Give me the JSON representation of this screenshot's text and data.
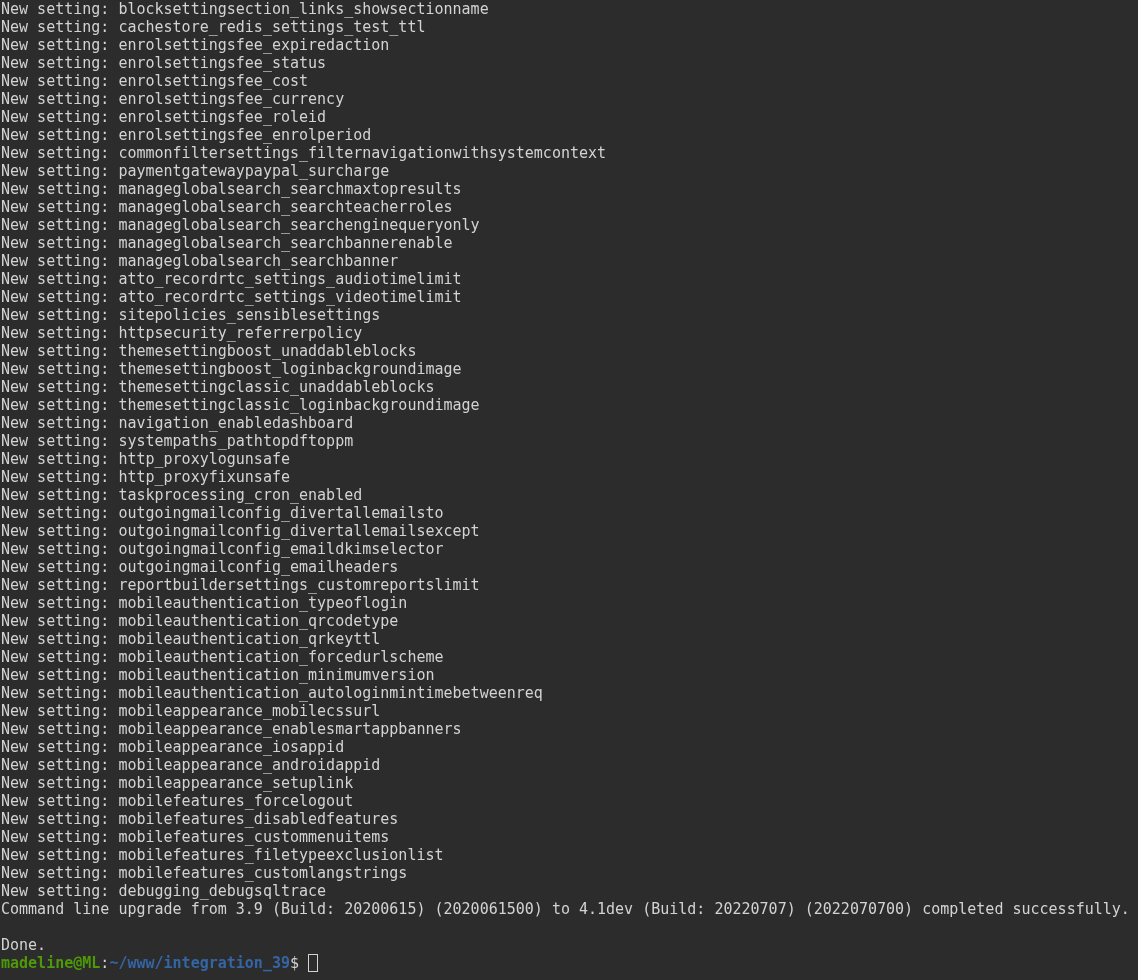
{
  "terminal": {
    "output": [
      "New setting: blocksettingsection_links_showsectionname",
      "New setting: cachestore_redis_settings_test_ttl",
      "New setting: enrolsettingsfee_expiredaction",
      "New setting: enrolsettingsfee_status",
      "New setting: enrolsettingsfee_cost",
      "New setting: enrolsettingsfee_currency",
      "New setting: enrolsettingsfee_roleid",
      "New setting: enrolsettingsfee_enrolperiod",
      "New setting: commonfiltersettings_filternavigationwithsystemcontext",
      "New setting: paymentgatewaypaypal_surcharge",
      "New setting: manageglobalsearch_searchmaxtopresults",
      "New setting: manageglobalsearch_searchteacherroles",
      "New setting: manageglobalsearch_searchenginequeryonly",
      "New setting: manageglobalsearch_searchbannerenable",
      "New setting: manageglobalsearch_searchbanner",
      "New setting: atto_recordrtc_settings_audiotimelimit",
      "New setting: atto_recordrtc_settings_videotimelimit",
      "New setting: sitepolicies_sensiblesettings",
      "New setting: httpsecurity_referrerpolicy",
      "New setting: themesettingboost_unaddableblocks",
      "New setting: themesettingboost_loginbackgroundimage",
      "New setting: themesettingclassic_unaddableblocks",
      "New setting: themesettingclassic_loginbackgroundimage",
      "New setting: navigation_enabledashboard",
      "New setting: systempaths_pathtopdftoppm",
      "New setting: http_proxylogunsafe",
      "New setting: http_proxyfixunsafe",
      "New setting: taskprocessing_cron_enabled",
      "New setting: outgoingmailconfig_divertallemailsto",
      "New setting: outgoingmailconfig_divertallemailsexcept",
      "New setting: outgoingmailconfig_emaildkimselector",
      "New setting: outgoingmailconfig_emailheaders",
      "New setting: reportbuildersettings_customreportslimit",
      "New setting: mobileauthentication_typeoflogin",
      "New setting: mobileauthentication_qrcodetype",
      "New setting: mobileauthentication_qrkeyttl",
      "New setting: mobileauthentication_forcedurlscheme",
      "New setting: mobileauthentication_minimumversion",
      "New setting: mobileauthentication_autologinmintimebetweenreq",
      "New setting: mobileappearance_mobilecssurl",
      "New setting: mobileappearance_enablesmartappbanners",
      "New setting: mobileappearance_iosappid",
      "New setting: mobileappearance_androidappid",
      "New setting: mobileappearance_setuplink",
      "New setting: mobilefeatures_forcelogout",
      "New setting: mobilefeatures_disabledfeatures",
      "New setting: mobilefeatures_custommenuitems",
      "New setting: mobilefeatures_filetypeexclusionlist",
      "New setting: mobilefeatures_customlangstrings",
      "New setting: debugging_debugsqltrace",
      "Command line upgrade from 3.9 (Build: 20200615) (2020061500) to 4.1dev (Build: 20220707) (2022070700) completed successfully."
    ],
    "result": "Done.",
    "prompt": {
      "user": "madeline@ML",
      "separator": ":",
      "path": "~/www/integration_39",
      "symbol": "$"
    }
  }
}
